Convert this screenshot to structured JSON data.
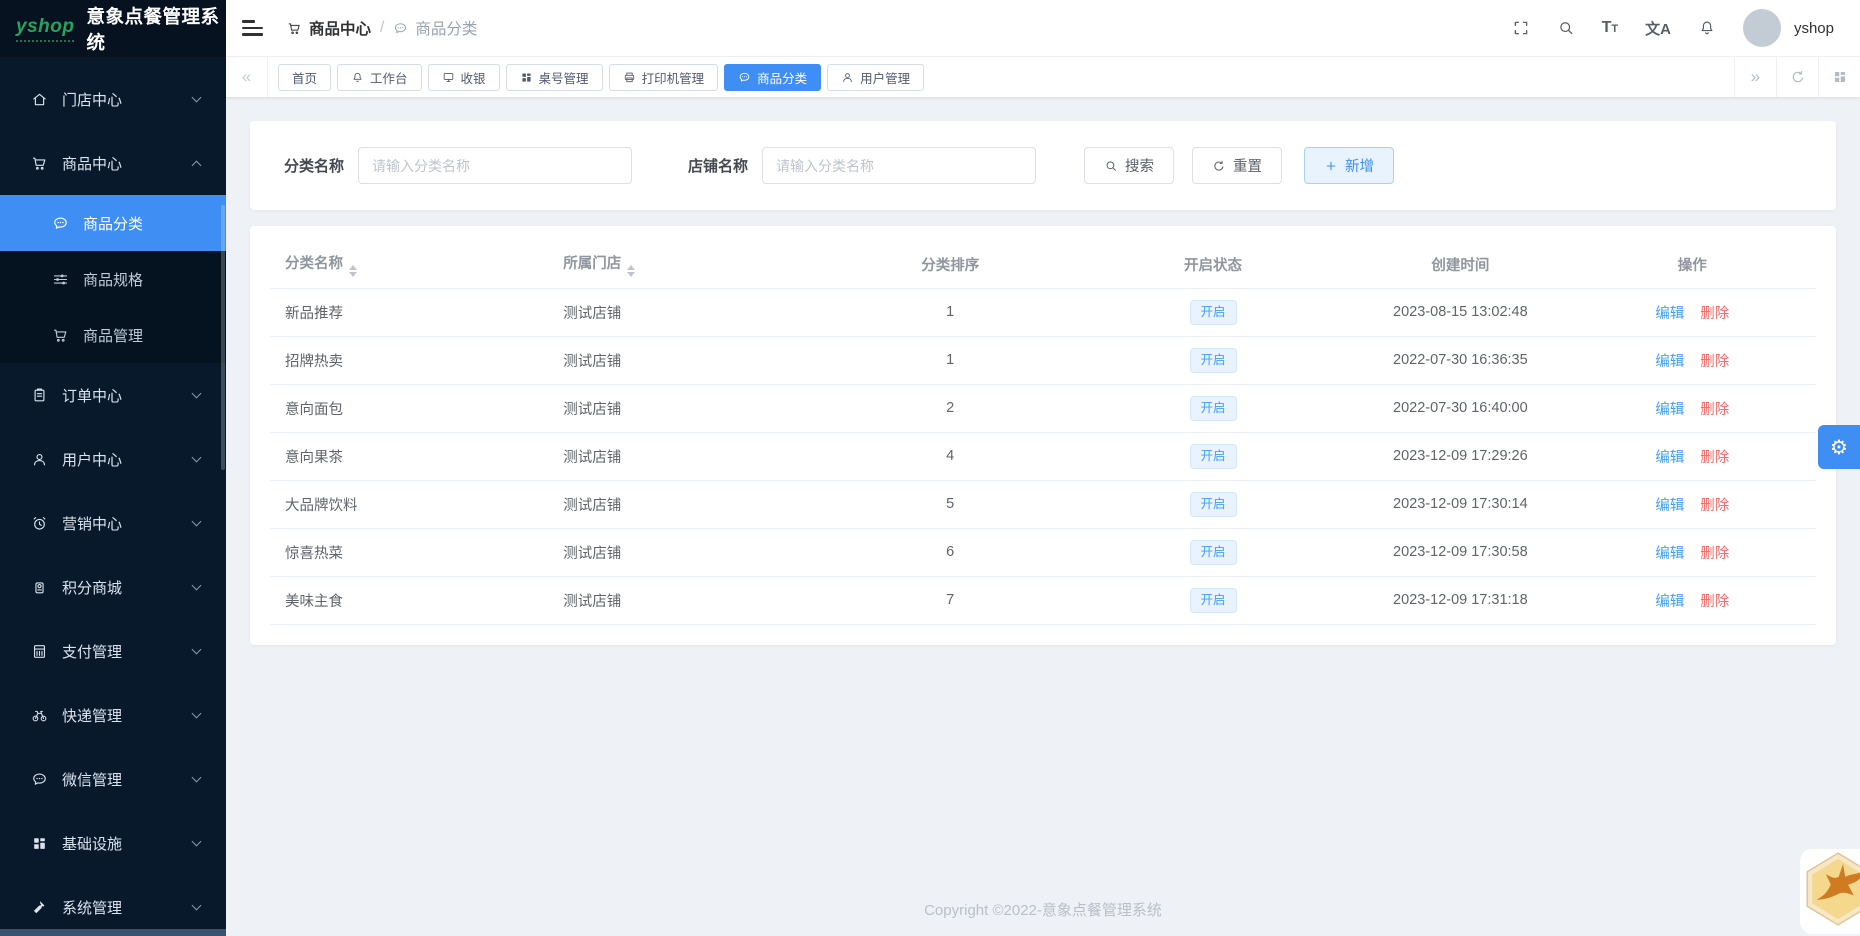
{
  "app": {
    "logo_text": "yshop",
    "title": "意象点餐管理系统"
  },
  "sidebar": {
    "items": [
      {
        "label": "门店中心",
        "icon": "home-icon",
        "expanded": false
      },
      {
        "label": "商品中心",
        "icon": "cart-icon",
        "expanded": true,
        "children": [
          {
            "label": "商品分类",
            "icon": "comment-icon",
            "active": true
          },
          {
            "label": "商品规格",
            "icon": "sliders-icon",
            "active": false
          },
          {
            "label": "商品管理",
            "icon": "cart-icon",
            "active": false
          }
        ]
      },
      {
        "label": "订单中心",
        "icon": "clipboard-icon",
        "expanded": false
      },
      {
        "label": "用户中心",
        "icon": "user-icon",
        "expanded": false
      },
      {
        "label": "营销中心",
        "icon": "alarm-icon",
        "expanded": false
      },
      {
        "label": "积分商城",
        "icon": "medal-icon",
        "expanded": false
      },
      {
        "label": "支付管理",
        "icon": "calculator-icon",
        "expanded": false
      },
      {
        "label": "快递管理",
        "icon": "bike-icon",
        "expanded": false
      },
      {
        "label": "微信管理",
        "icon": "comment-icon",
        "expanded": false
      },
      {
        "label": "基础设施",
        "icon": "grid-icon",
        "expanded": false
      },
      {
        "label": "系统管理",
        "icon": "hammer-icon",
        "expanded": false
      }
    ]
  },
  "header": {
    "breadcrumb": {
      "section": "商品中心",
      "page": "商品分类",
      "separator": "/"
    },
    "tools": {
      "font_large": "T",
      "font_small": "T",
      "translate_glyph": "文A"
    },
    "username": "yshop"
  },
  "tabbar": {
    "collapse_left": "«",
    "collapse_right": "»",
    "tabs": [
      {
        "label": "首页",
        "icon": null,
        "active": false
      },
      {
        "label": "工作台",
        "icon": "bell-icon",
        "active": false
      },
      {
        "label": "收银",
        "icon": "monitor-icon",
        "active": false
      },
      {
        "label": "桌号管理",
        "icon": "grid-icon",
        "active": false
      },
      {
        "label": "打印机管理",
        "icon": "printer-icon",
        "active": false
      },
      {
        "label": "商品分类",
        "icon": "comment-icon",
        "active": true
      },
      {
        "label": "用户管理",
        "icon": "user-icon",
        "active": false
      }
    ]
  },
  "filters": {
    "category_label": "分类名称",
    "category_placeholder": "请输入分类名称",
    "shop_label": "店铺名称",
    "shop_placeholder": "请输入分类名称",
    "search_label": "搜索",
    "reset_label": "重置",
    "add_label": "新增"
  },
  "table": {
    "columns": [
      {
        "label": "分类名称",
        "sortable": true
      },
      {
        "label": "所属门店",
        "sortable": true
      },
      {
        "label": "分类排序",
        "sortable": false
      },
      {
        "label": "开启状态",
        "sortable": false
      },
      {
        "label": "创建时间",
        "sortable": false
      },
      {
        "label": "操作",
        "sortable": false
      }
    ],
    "actions": {
      "edit": "编辑",
      "delete": "删除"
    },
    "rows": [
      {
        "name": "新品推荐",
        "shop": "测试店铺",
        "sort": "1",
        "status": "开启",
        "created": "2023-08-15 13:02:48"
      },
      {
        "name": "招牌热卖",
        "shop": "测试店铺",
        "sort": "1",
        "status": "开启",
        "created": "2022-07-30 16:36:35"
      },
      {
        "name": "意向面包",
        "shop": "测试店铺",
        "sort": "2",
        "status": "开启",
        "created": "2022-07-30 16:40:00"
      },
      {
        "name": "意向果茶",
        "shop": "测试店铺",
        "sort": "4",
        "status": "开启",
        "created": "2023-12-09 17:29:26"
      },
      {
        "name": "大品牌饮料",
        "shop": "测试店铺",
        "sort": "5",
        "status": "开启",
        "created": "2023-12-09 17:30:14"
      },
      {
        "name": "惊喜热菜",
        "shop": "测试店铺",
        "sort": "6",
        "status": "开启",
        "created": "2023-12-09 17:30:58"
      },
      {
        "name": "美味主食",
        "shop": "测试店铺",
        "sort": "7",
        "status": "开启",
        "created": "2023-12-09 17:31:18"
      }
    ]
  },
  "footer": {
    "copyright": "Copyright ©2022-意象点餐管理系统"
  },
  "gear": {
    "glyph": "⚙"
  },
  "colors": {
    "primary": "#3e8ef3",
    "link_blue": "#409eff",
    "danger_red": "#f56c6c",
    "sidebar_bg": "#08192b",
    "tag_bg": "#e9f3fd",
    "content_bg": "#eef1f5"
  }
}
